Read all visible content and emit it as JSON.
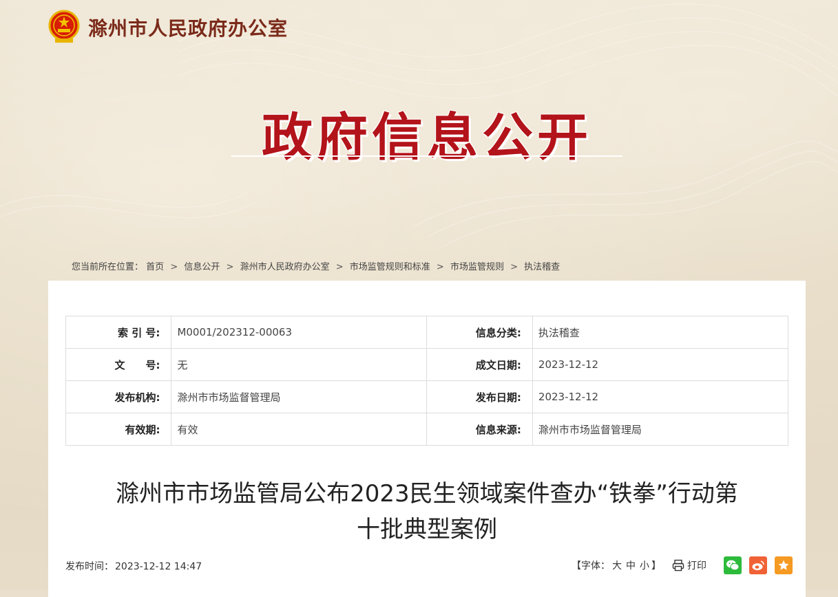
{
  "header": {
    "site_title": "滁州市人民政府办公室"
  },
  "banner": {
    "title": "政府信息公开"
  },
  "breadcrumb": {
    "prefix": "您当前所在位置：",
    "items": [
      "首页",
      "信息公开",
      "滁州市人民政府办公室",
      "市场监管规则和标准",
      "市场监管规则",
      "执法稽查"
    ],
    "separator": ">"
  },
  "meta": {
    "rows": [
      {
        "k1": "索 引 号:",
        "v1": "M0001/202312-00063",
        "k2": "信息分类:",
        "v2": "执法稽查"
      },
      {
        "k1": "文　　号:",
        "v1": "无",
        "k2": "成文日期:",
        "v2": "2023-12-12"
      },
      {
        "k1": "发布机构:",
        "v1": "滁州市市场监督管理局",
        "k2": "发布日期:",
        "v2": "2023-12-12"
      },
      {
        "k1": "有效期:",
        "v1": "有效",
        "k2": "信息来源:",
        "v2": "滁州市市场监督管理局"
      }
    ]
  },
  "article": {
    "title_line1": "滁州市市场监管局公布2023民生领域案件查办“铁拳”行动第",
    "title_line2": "十批典型案例",
    "publish_label": "发布时间：",
    "publish_time": "2023-12-12 14:47"
  },
  "toolbar": {
    "font_open": "【字体：",
    "font_large": "大",
    "font_medium": "中",
    "font_small": "小",
    "font_close": "】",
    "print_label": "打印",
    "icons": [
      "printer-icon",
      "wechat-icon",
      "weibo-icon",
      "star-icon"
    ]
  },
  "colors": {
    "banner_red": "#b3131a",
    "header_brown": "#7b2a1a",
    "wechat_green": "#2dbb3c",
    "weibo_orange": "#f06236",
    "fav_orange": "#f59a23"
  }
}
